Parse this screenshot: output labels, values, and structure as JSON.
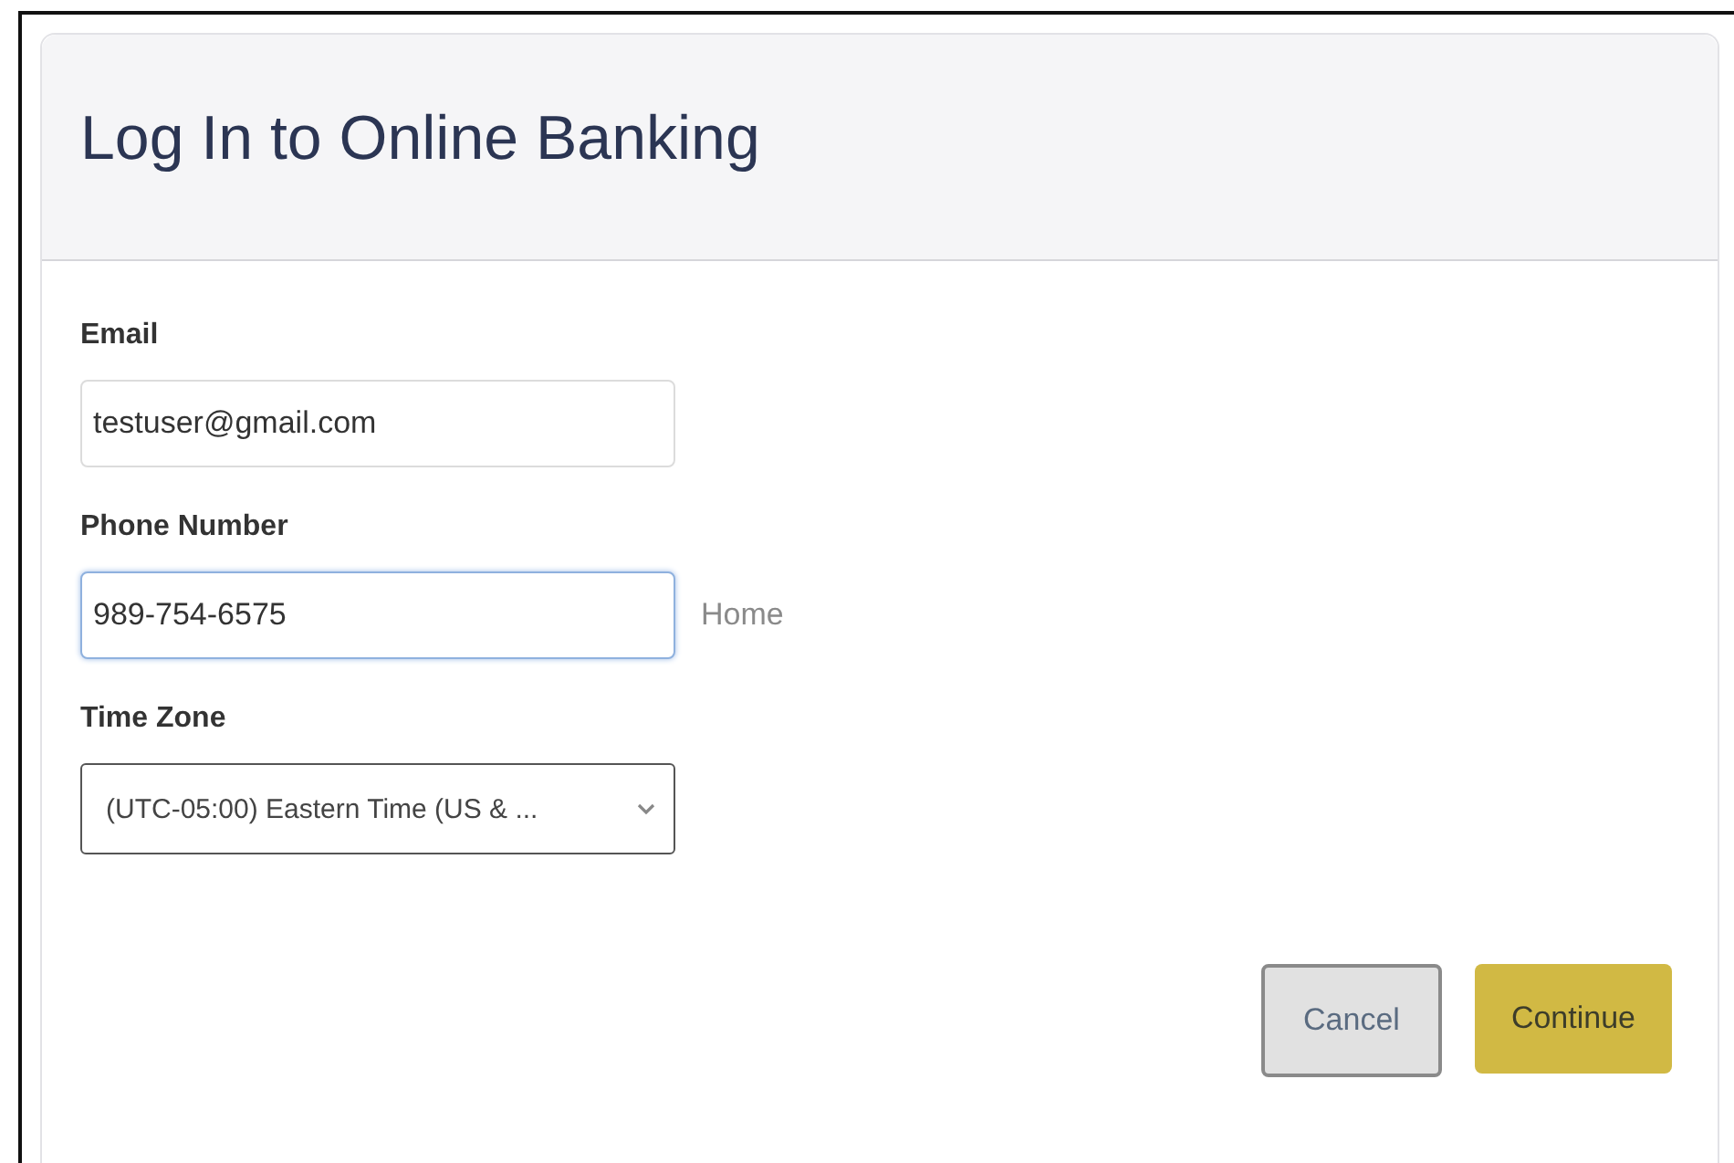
{
  "dialog": {
    "title": "Log In to Online Banking"
  },
  "fields": [
    {
      "kind": "text",
      "label": "Email",
      "value": "testuser@gmail.com",
      "focused": false
    },
    {
      "kind": "text",
      "label": "Phone Number",
      "value": "989-754-6575",
      "focused": true,
      "suffix": "Home"
    },
    {
      "kind": "select",
      "label": "Time Zone",
      "value": "(UTC-05:00) Eastern Time (US & ..."
    }
  ],
  "buttons": [
    {
      "kind": "secondary",
      "label": "Cancel"
    },
    {
      "kind": "primary",
      "label": "Continue"
    }
  ]
}
